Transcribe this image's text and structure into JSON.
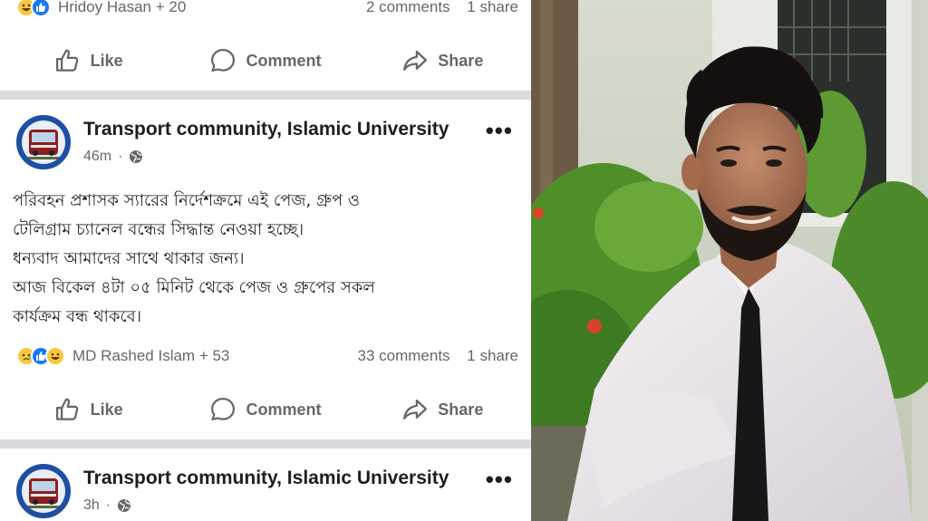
{
  "post_top": {
    "reactors": "Hridoy Hasan + 20",
    "comments": "2 comments",
    "shares": "1 share"
  },
  "actions": {
    "like": "Like",
    "comment": "Comment",
    "share": "Share"
  },
  "post_main": {
    "author": "Transport community, Islamic University",
    "time": "46m",
    "text_lines": [
      "পরিবহন প্রশাসক স্যারের নির্দেশক্রমে এই পেজ, গ্রুপ ও",
      "টেলিগ্রাম চ্যানেল বন্ধের সিদ্ধান্ত নেওয়া হচ্ছে।",
      "ধন্যবাদ আমাদের সাথে থাকার জন্য।",
      "আজ বিকেল ৪টা ০৫ মিনিট থেকে পেজ ও গ্রুপের সকল",
      "কার্যক্রম বন্ধ থাকবে।"
    ],
    "reactors": "MD Rashed Islam + 53",
    "comments": "33 comments",
    "shares": "1 share"
  },
  "post_next": {
    "author": "Transport community, Islamic University",
    "time": "3h"
  },
  "colors": {
    "facebook_blue": "#1877f2",
    "divider": "#d9dbdf",
    "secondary_text": "#65676b"
  }
}
